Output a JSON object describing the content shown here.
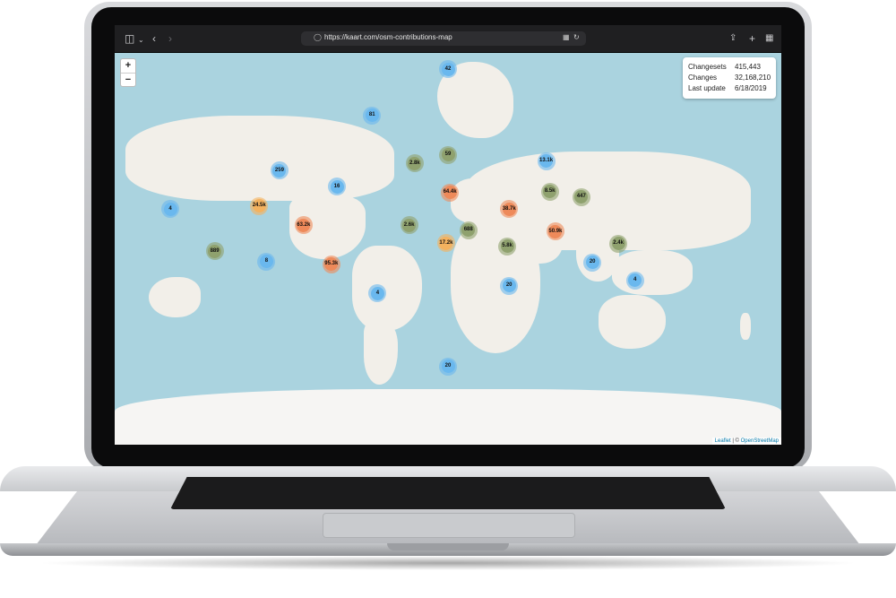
{
  "browser": {
    "url": "https://kaart.com/osm-contributions-map",
    "icons": [
      "sidebar-icon",
      "chevron-down-icon",
      "back-icon",
      "forward-icon",
      "privacy-shield-icon",
      "translate-icon",
      "reload-icon",
      "share-icon",
      "new-tab-icon",
      "tab-overview-icon"
    ]
  },
  "map": {
    "zoom": {
      "in_label": "+",
      "out_label": "−"
    },
    "stats": {
      "changesets_label": "Changesets",
      "changesets_value": "415,443",
      "changes_label": "Changes",
      "changes_value": "32,168,210",
      "last_update_label": "Last update",
      "last_update_value": "6/18/2019"
    },
    "attribution": {
      "leaflet": "Leaflet",
      "separator": " | © ",
      "osm": "OpenStreetMap"
    },
    "colors": {
      "small": "#6ab8ee",
      "medium": "#8fa16e",
      "large": "#f4b25f",
      "xlarge": "#ee8a5a"
    },
    "clusters": [
      {
        "label": "42",
        "lat": 82.5,
        "lng": 0.0,
        "size": "small"
      },
      {
        "label": "81",
        "lat": 75.0,
        "lng": -41.0,
        "size": "small"
      },
      {
        "label": "59",
        "lat": 63.0,
        "lng": 0.0,
        "size": "medium"
      },
      {
        "label": "2.8k",
        "lat": 59.5,
        "lng": -18.0,
        "size": "medium"
      },
      {
        "label": "13.1k",
        "lat": 60.5,
        "lng": 53.0,
        "size": "small"
      },
      {
        "label": "259",
        "lat": 56.0,
        "lng": -91.0,
        "size": "small"
      },
      {
        "label": "16",
        "lat": 47.5,
        "lng": -60.0,
        "size": "small"
      },
      {
        "label": "64.4k",
        "lat": 44.0,
        "lng": 1.0,
        "size": "xlarge"
      },
      {
        "label": "8.5k",
        "lat": 44.5,
        "lng": 55.0,
        "size": "medium"
      },
      {
        "label": "447",
        "lat": 41.0,
        "lng": 72.0,
        "size": "medium"
      },
      {
        "label": "24.5k",
        "lat": 35.0,
        "lng": -102.0,
        "size": "large"
      },
      {
        "label": "4",
        "lat": 32.5,
        "lng": -150.0,
        "size": "small"
      },
      {
        "label": "38.7k",
        "lat": 32.5,
        "lng": 33.0,
        "size": "xlarge"
      },
      {
        "label": "63.2k",
        "lat": 20.0,
        "lng": -78.0,
        "size": "xlarge"
      },
      {
        "label": "2.6k",
        "lat": 20.0,
        "lng": -21.0,
        "size": "medium"
      },
      {
        "label": "688",
        "lat": 16.0,
        "lng": 11.0,
        "size": "medium"
      },
      {
        "label": "50.9k",
        "lat": 15.0,
        "lng": 58.0,
        "size": "xlarge"
      },
      {
        "label": "17.2k",
        "lat": 5.0,
        "lng": -1.0,
        "size": "large"
      },
      {
        "label": "5.8k",
        "lat": 2.0,
        "lng": 32.0,
        "size": "medium"
      },
      {
        "label": "2.4k",
        "lat": 4.5,
        "lng": 92.0,
        "size": "medium"
      },
      {
        "label": "889",
        "lat": -2.0,
        "lng": -126.0,
        "size": "medium"
      },
      {
        "label": "8",
        "lat": -11.0,
        "lng": -98.0,
        "size": "small"
      },
      {
        "label": "95.3k",
        "lat": -13.5,
        "lng": -63.0,
        "size": "xlarge"
      },
      {
        "label": "20",
        "lat": -12.0,
        "lng": 78.0,
        "size": "small"
      },
      {
        "label": "4",
        "lat": -26.5,
        "lng": 101.0,
        "size": "small"
      },
      {
        "label": "20",
        "lat": -30.5,
        "lng": 33.0,
        "size": "small"
      },
      {
        "label": "4",
        "lat": -36.0,
        "lng": -38.0,
        "size": "small"
      },
      {
        "label": "20",
        "lat": -71.0,
        "lng": 0.0,
        "size": "small"
      }
    ]
  }
}
